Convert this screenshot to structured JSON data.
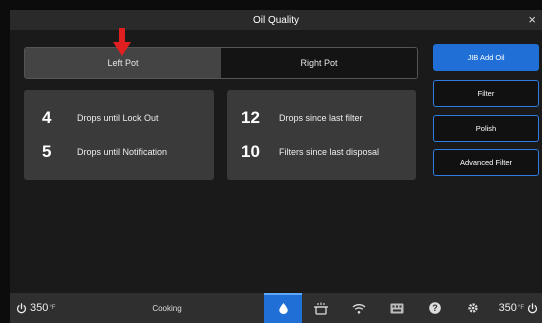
{
  "window": {
    "title": "Oil Quality",
    "close_label": "×"
  },
  "tabs": [
    {
      "label": "Left Pot",
      "active": true
    },
    {
      "label": "Right Pot",
      "active": false
    }
  ],
  "stats_left": [
    {
      "value": "4",
      "label": "Drops until Lock Out"
    },
    {
      "value": "5",
      "label": "Drops until Notification"
    }
  ],
  "stats_right": [
    {
      "value": "12",
      "label": "Drops since last filter"
    },
    {
      "value": "10",
      "label": "Filters since last disposal"
    }
  ],
  "actions": [
    {
      "label": "JIB Add Oil",
      "primary": true
    },
    {
      "label": "Filter",
      "primary": false
    },
    {
      "label": "Polish",
      "primary": false
    },
    {
      "label": "Advanced Filter",
      "primary": false
    }
  ],
  "bottom": {
    "left_temp": "350",
    "right_temp": "350",
    "status": "Cooking",
    "icons": [
      "oil-drop-icon",
      "pot-icon",
      "wifi-icon",
      "keyboard-icon",
      "help-icon",
      "settings-icon"
    ],
    "active_icon": "oil-drop-icon"
  },
  "colors": {
    "accent": "#1f6fd6",
    "panel": "#3a3a3a",
    "background": "#1a1a1a",
    "arrow": "#e02020"
  }
}
